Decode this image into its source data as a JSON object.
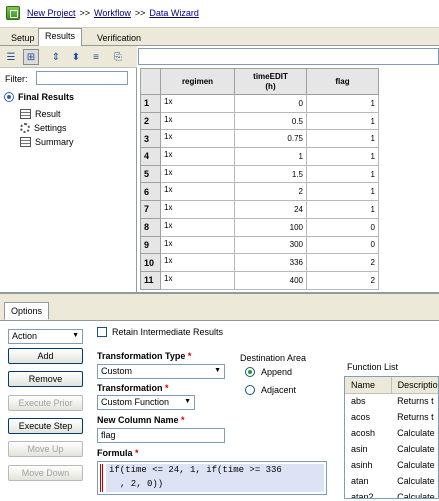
{
  "breadcrumb": {
    "items": [
      "New Project",
      "Workflow",
      "Data Wizard"
    ],
    "sep1": ">>",
    "sep2": ">>"
  },
  "top_tabs": [
    "Setup",
    "Results",
    "Verification"
  ],
  "left_panel": {
    "filter_label": "Filter:",
    "filter_value": "",
    "tree_root": "Final Results",
    "tree_children": [
      "Result",
      "Settings",
      "Summary"
    ]
  },
  "grid": {
    "columns": [
      "regimen",
      "timeEDIT\n(h)",
      "flag"
    ],
    "rows": [
      [
        "1",
        "1x",
        "0",
        "1"
      ],
      [
        "2",
        "1x",
        "0.5",
        "1"
      ],
      [
        "3",
        "1x",
        "0.75",
        "1"
      ],
      [
        "4",
        "1x",
        "1",
        "1"
      ],
      [
        "5",
        "1x",
        "1.5",
        "1"
      ],
      [
        "6",
        "1x",
        "2",
        "1"
      ],
      [
        "7",
        "1x",
        "24",
        "1"
      ],
      [
        "8",
        "1x",
        "100",
        "0"
      ],
      [
        "9",
        "1x",
        "300",
        "0"
      ],
      [
        "10",
        "1x",
        "336",
        "2"
      ],
      [
        "11",
        "1x",
        "400",
        "2"
      ]
    ]
  },
  "options": {
    "tab": "Options",
    "action_select": "Action",
    "buttons": [
      "Add",
      "Remove",
      "Execute Prior",
      "Execute Step",
      "Move Up",
      "Move Down"
    ],
    "retain_label": "Retain Intermediate Results",
    "transformation_type_label": "Transformation Type",
    "transformation_type_value": "Custom",
    "transformation_label": "Transformation",
    "transformation_value": "Custom Function",
    "new_column_label": "New Column Name",
    "new_column_value": "flag",
    "formula_label": "Formula",
    "formula_line1": "if(time <= 24, 1, if(time >= 336",
    "formula_line2": ", 2, 0))",
    "required_mark": "*",
    "destination_label": "Destination Area",
    "destination_options": [
      "Append",
      "Adjacent"
    ],
    "destination_selected": "Append"
  },
  "function_list": {
    "title": "Function List",
    "headers": [
      "Name",
      "Description"
    ],
    "rows": [
      [
        "abs",
        "Returns t"
      ],
      [
        "acos",
        "Returns t"
      ],
      [
        "acosh",
        "Calculate"
      ],
      [
        "asin",
        "Calculate"
      ],
      [
        "asinh",
        "Calculate"
      ],
      [
        "atan",
        "Calculate"
      ],
      [
        "atan2",
        "Calculate"
      ]
    ]
  }
}
